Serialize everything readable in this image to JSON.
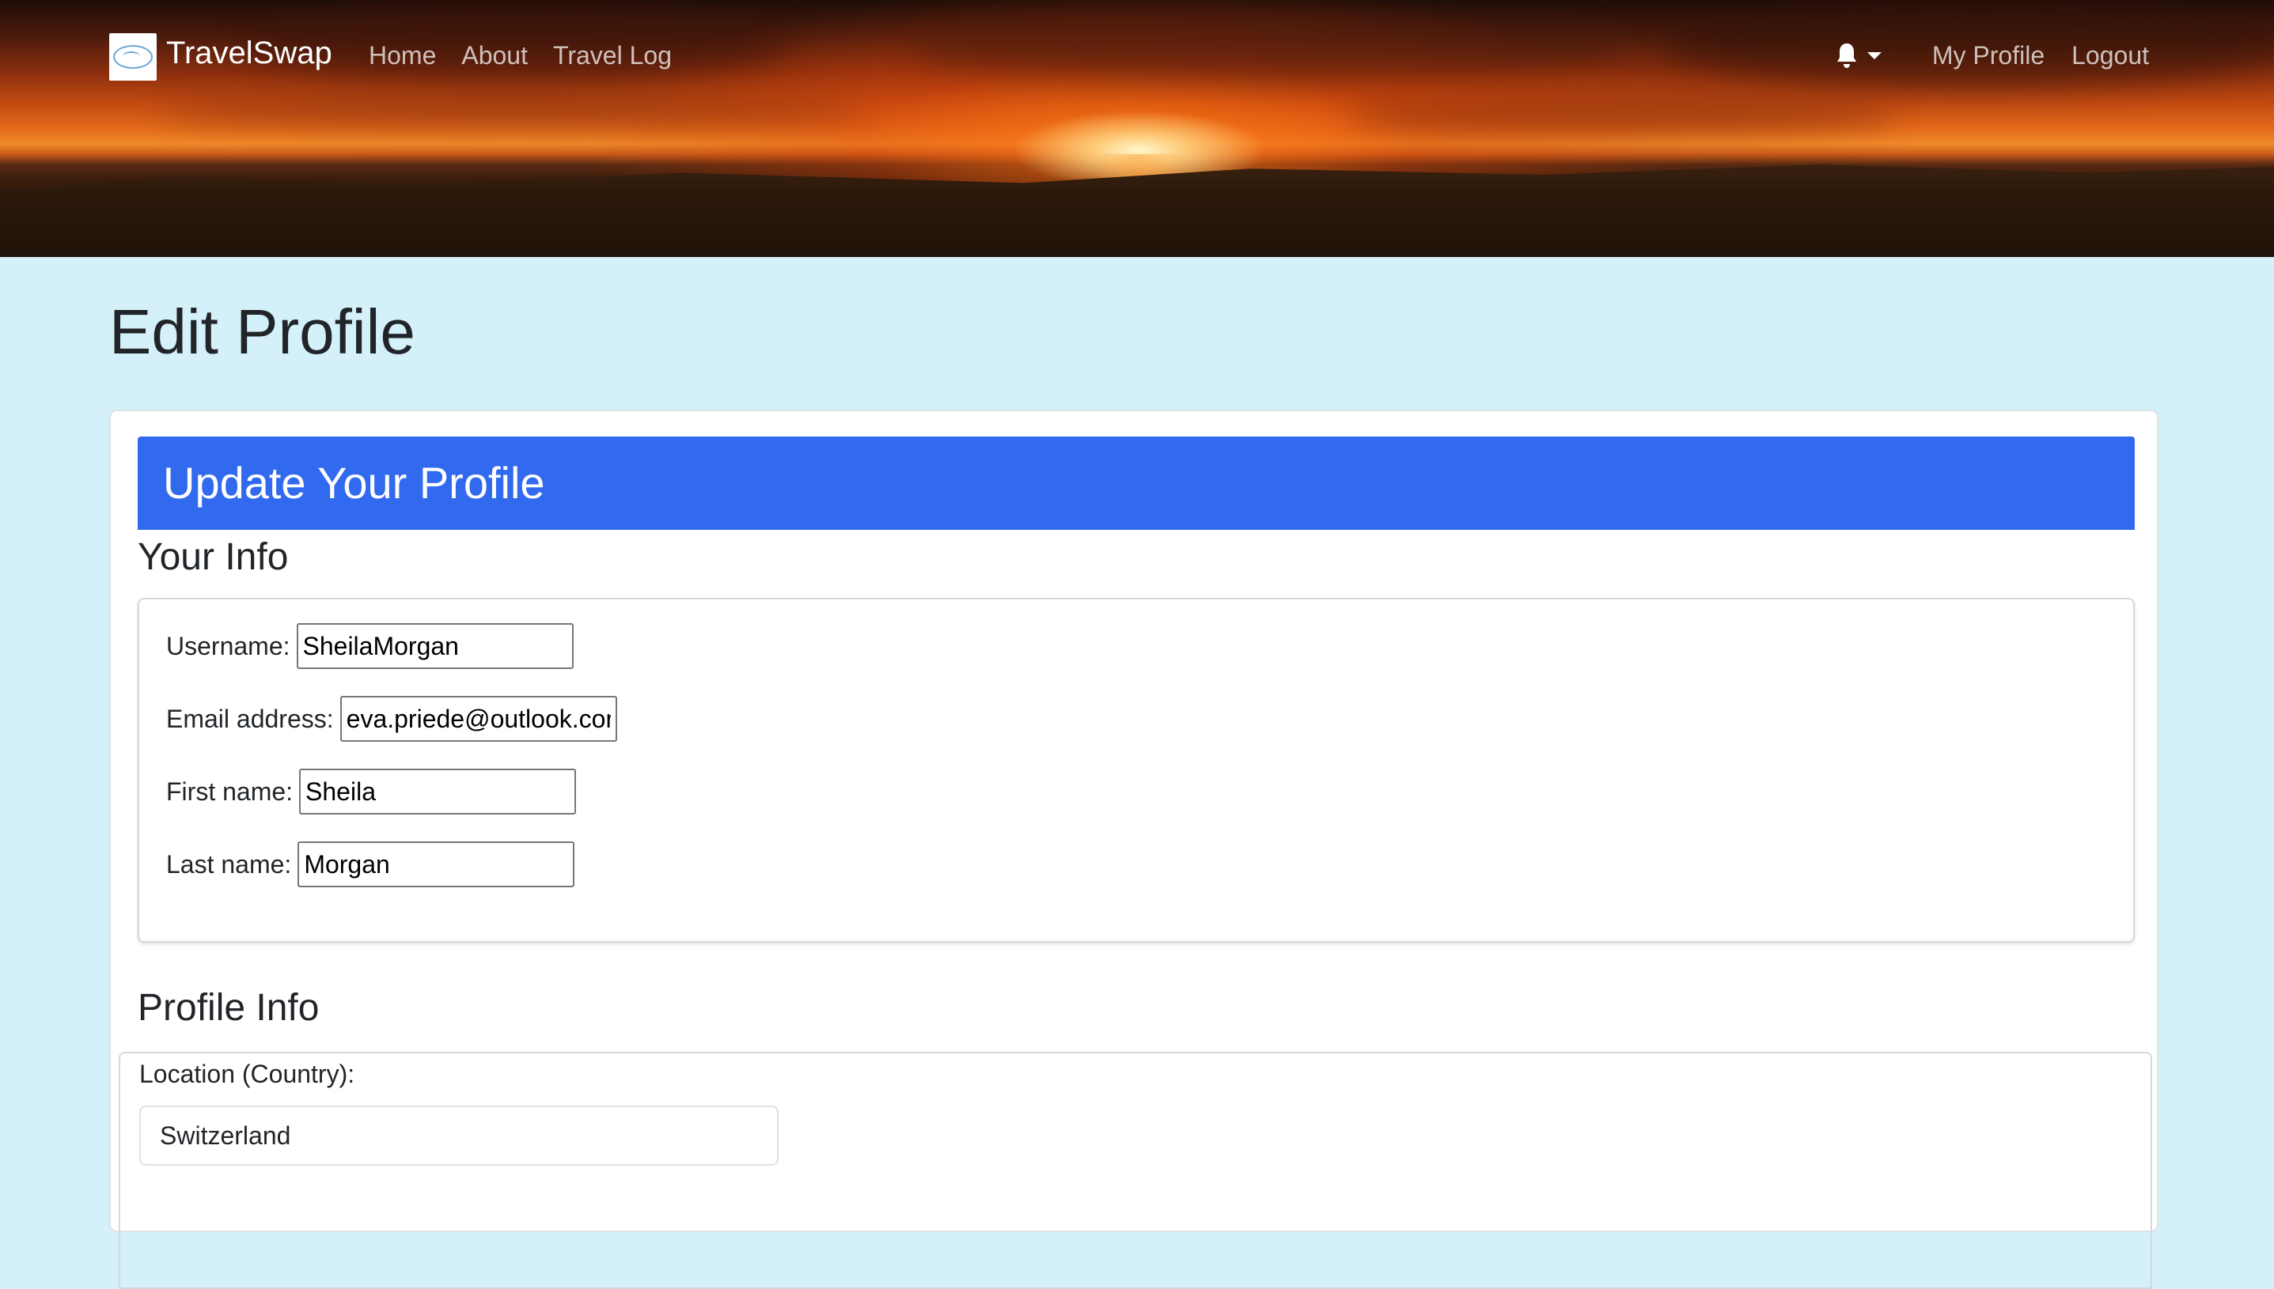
{
  "navbar": {
    "brand_name": "TravelSwap",
    "logo_alt": "Travel Swap",
    "links": {
      "home": "Home",
      "about": "About",
      "travel_log": "Travel Log"
    },
    "right_links": {
      "my_profile": "My Profile",
      "logout": "Logout"
    },
    "icons": {
      "notifications": "bell-icon",
      "dropdown": "caret-down-icon"
    }
  },
  "page": {
    "title": "Edit Profile"
  },
  "card": {
    "header": "Update Your Profile",
    "accent_color": "#316aee"
  },
  "your_info": {
    "title": "Your Info",
    "username_label": "Username:",
    "username_value": "SheilaMorgan",
    "email_label": "Email address:",
    "email_value": "eva.priede@outlook.com",
    "first_name_label": "First name:",
    "first_name_value": "Sheila",
    "last_name_label": "Last name:",
    "last_name_value": "Morgan"
  },
  "profile_info": {
    "title": "Profile Info",
    "location_label": "Location (Country):",
    "location_value": "Switzerland"
  },
  "colors": {
    "page_background": "#d4f0f8",
    "text": "#212529"
  }
}
